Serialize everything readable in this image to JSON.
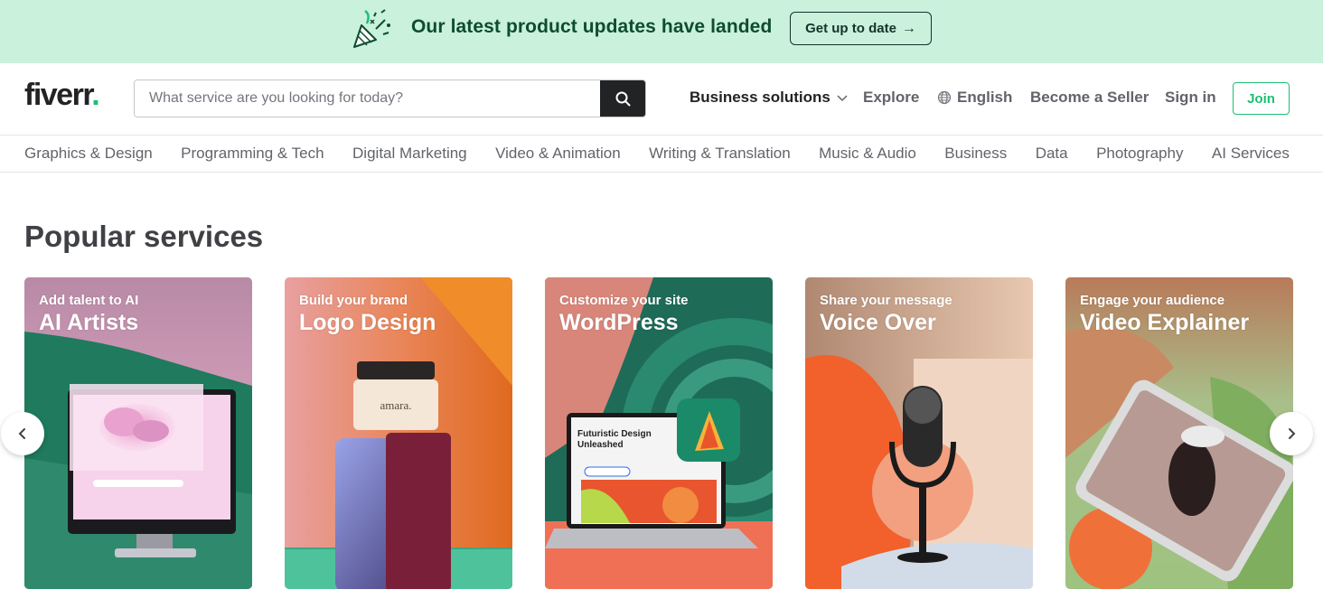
{
  "banner": {
    "text": "Our latest product updates have landed",
    "button_label": "Get up to date",
    "button_arrow": "→"
  },
  "header": {
    "logo_text": "fiverr",
    "logo_dot": ".",
    "search_placeholder": "What service are you looking for today?",
    "nav": {
      "business": "Business solutions",
      "explore": "Explore",
      "language": "English",
      "seller": "Become a Seller",
      "signin": "Sign in",
      "join": "Join"
    }
  },
  "categories": [
    "Graphics & Design",
    "Programming & Tech",
    "Digital Marketing",
    "Video & Animation",
    "Writing & Translation",
    "Music & Audio",
    "Business",
    "Data",
    "Photography",
    "AI Services"
  ],
  "popular": {
    "title": "Popular services",
    "cards": [
      {
        "subtitle": "Add talent to AI",
        "title": "AI Artists"
      },
      {
        "subtitle": "Build your brand",
        "title": "Logo Design"
      },
      {
        "subtitle": "Customize your site",
        "title": "WordPress"
      },
      {
        "subtitle": "Share your message",
        "title": "Voice Over"
      },
      {
        "subtitle": "Engage your audience",
        "title": "Video Explainer"
      }
    ]
  },
  "art_text": {
    "jar_label": "amara.",
    "laptop_headline_1": "Futuristic Design",
    "laptop_headline_2": "Unleashed"
  },
  "colors": {
    "brand_green": "#1dbf73",
    "banner_bg": "#c9f1dc",
    "banner_text": "#0e4c2e"
  },
  "icons": {
    "banner": "party-popper-icon",
    "search": "search-icon",
    "chevron": "chevron-down-icon",
    "globe": "globe-icon",
    "prev": "chevron-left-icon",
    "next": "chevron-right-icon"
  }
}
